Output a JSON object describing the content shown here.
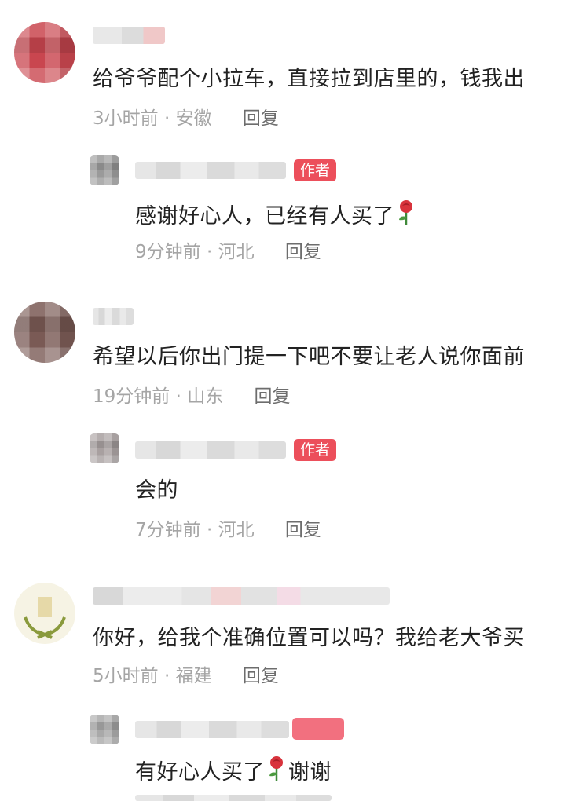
{
  "comments": [
    {
      "text": "给爷爷配个小拉车，直接拉到店里的，钱我出",
      "time": "3小时前",
      "location": "安徽",
      "reply_label": "回复",
      "reply": {
        "badge": "作者",
        "text": "感谢好心人，已经有人买了",
        "time": "9分钟前",
        "location": "河北",
        "reply_label": "回复"
      }
    },
    {
      "text": "希望以后你出门提一下吧不要让老人说你面前",
      "time": "19分钟前",
      "location": "山东",
      "reply_label": "回复",
      "reply": {
        "badge": "作者",
        "text": "会的",
        "time": "7分钟前",
        "location": "河北",
        "reply_label": "回复"
      }
    },
    {
      "text": "你好，给我个准确位置可以吗？我给老大爷买",
      "time": "5小时前",
      "location": "福建",
      "reply_label": "回复",
      "reply": {
        "text_before": "有好心人买了",
        "text_after": "谢谢"
      }
    }
  ],
  "separator": "·"
}
